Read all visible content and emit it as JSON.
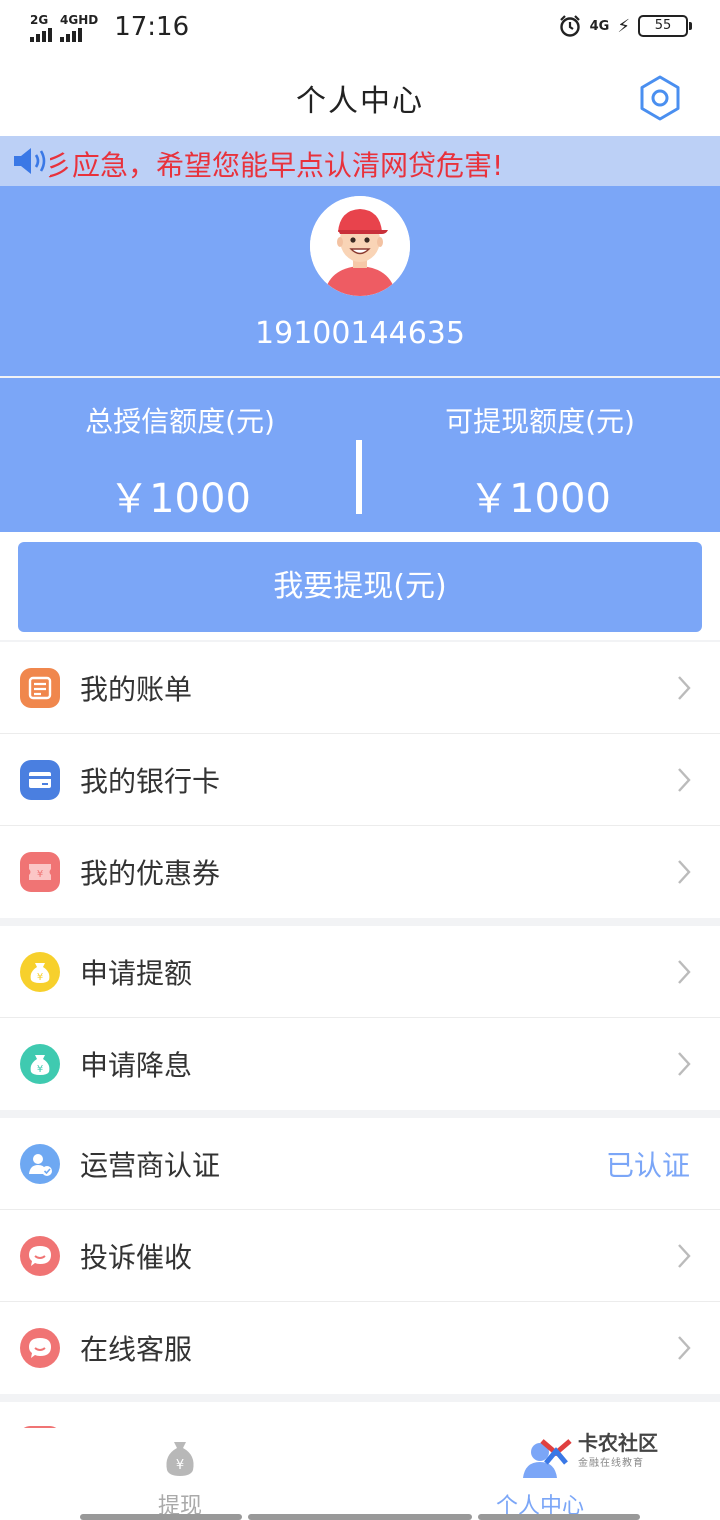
{
  "status_bar": {
    "signal_1": "2G",
    "signal_2": "4GHD",
    "time": "17:16",
    "network": "4G",
    "battery": "55"
  },
  "header": {
    "title": "个人中心"
  },
  "notice": {
    "text": "彡应急，希望您能早点认清网贷危害!"
  },
  "profile": {
    "phone": "19100144635"
  },
  "credit": {
    "total_label": "总授信额度(元)",
    "total_value": "￥1000",
    "withdrawable_label": "可提现额度(元)",
    "withdrawable_value": "￥1000"
  },
  "withdraw_button": "我要提现(元)",
  "menu": {
    "group1": [
      {
        "label": "我的账单",
        "icon": "bill-icon",
        "color": "#f0874d"
      },
      {
        "label": "我的银行卡",
        "icon": "bank-card-icon",
        "color": "#4a7fe0"
      },
      {
        "label": "我的优惠券",
        "icon": "coupon-icon",
        "color": "#f07474"
      }
    ],
    "group2": [
      {
        "label": "申请提额",
        "icon": "money-bag-icon",
        "color": "#f7d02c"
      },
      {
        "label": "申请降息",
        "icon": "money-bag-icon",
        "color": "#3fcab0"
      }
    ],
    "group3": [
      {
        "label": "运营商认证",
        "icon": "user-verified-icon",
        "color": "#6ea8f2",
        "status": "已认证"
      },
      {
        "label": "投诉催收",
        "icon": "chat-bubble-icon",
        "color": "#f07474"
      },
      {
        "label": "在线客服",
        "icon": "chat-bubble-icon",
        "color": "#f07474"
      }
    ]
  },
  "tabs": {
    "withdraw": "提现",
    "profile": "个人中心"
  },
  "watermark": {
    "title": "卡农社区",
    "subtitle": "金融在线教育"
  },
  "colors": {
    "accent": "#7ba6f7",
    "notice_text": "#e8323c",
    "notice_bg": "#bcd0f6"
  }
}
